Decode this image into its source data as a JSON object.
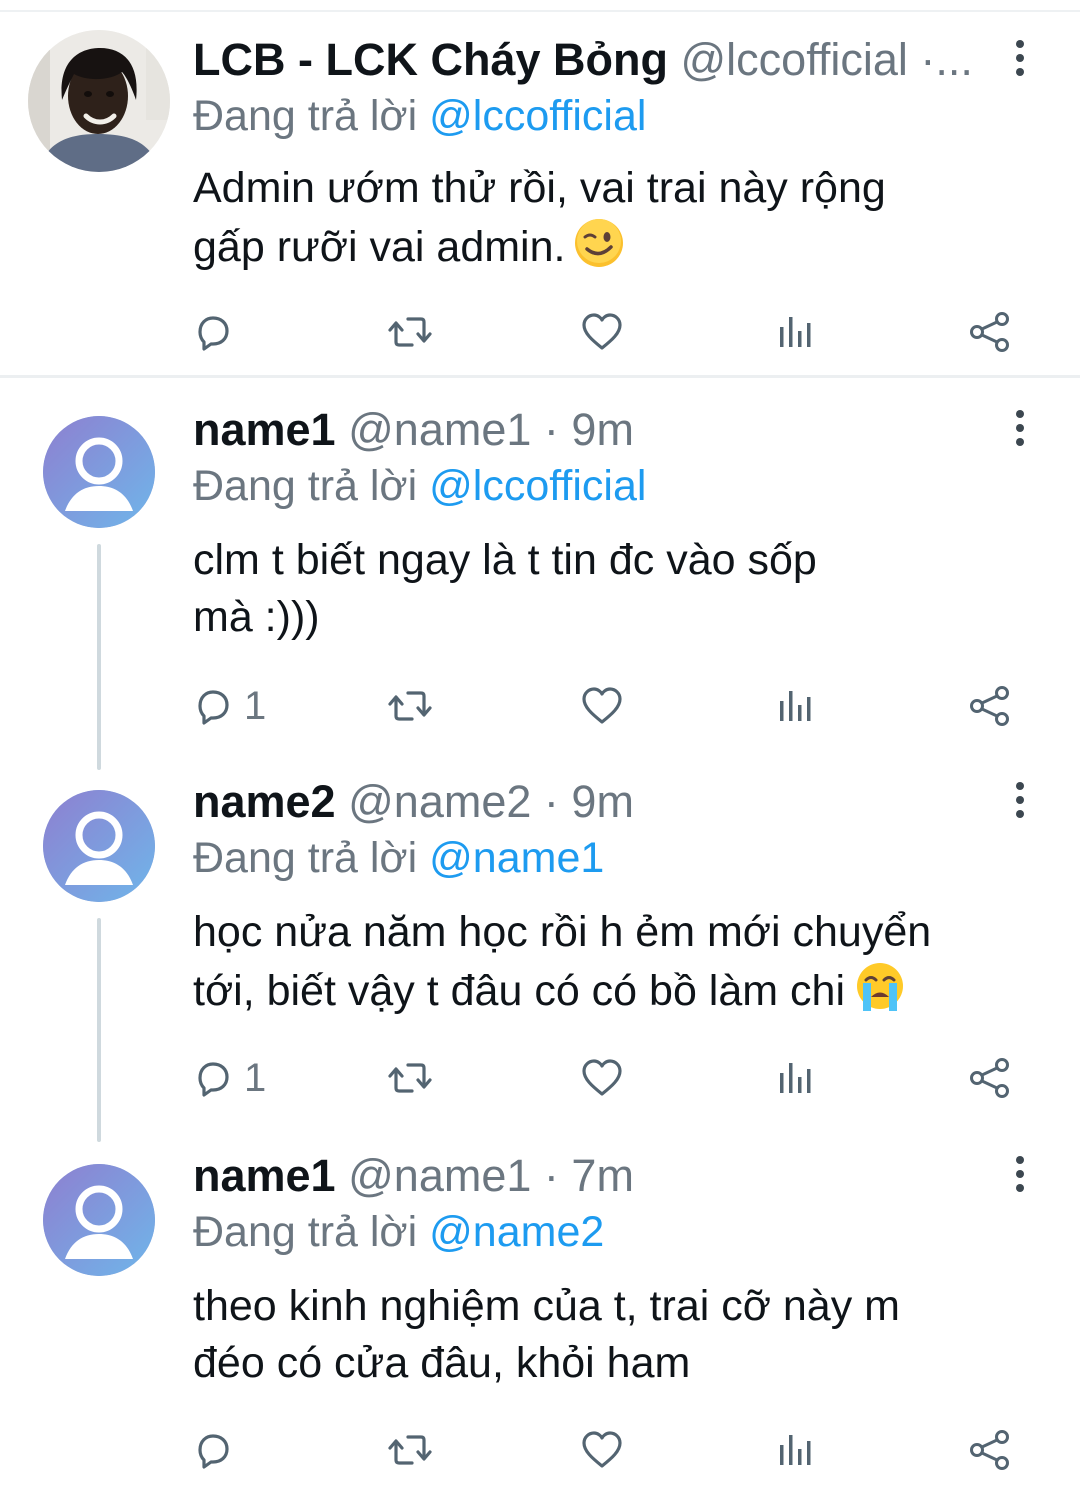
{
  "tweets": [
    {
      "avatar": "user-photo",
      "name": "LCB - LCK Cháy Bỏng",
      "handle": "@lccofficial",
      "time_sep": "·...",
      "time": "",
      "reply_prefix": "Đang trả lời",
      "reply_to": "@lccofficial",
      "lines": [
        "Admin ướm thử rồi, vai trai này rộng",
        "gấp rưỡi vai admin."
      ],
      "emoji": "winking-face-emoji",
      "reply_count": ""
    },
    {
      "avatar": "default-avatar-icon",
      "name": "name1",
      "handle": "@name1",
      "time_sep": "·",
      "time": "9m",
      "reply_prefix": "Đang trả lời",
      "reply_to": "@lccofficial",
      "lines": [
        "clm t biết ngay là t tin đc vào sốp",
        "mà :)))"
      ],
      "emoji": "",
      "reply_count": "1"
    },
    {
      "avatar": "default-avatar-icon",
      "name": "name2",
      "handle": "@name2",
      "time_sep": "·",
      "time": "9m",
      "reply_prefix": "Đang trả lời",
      "reply_to": "@name1",
      "lines": [
        "học nửa năm học rồi h ẻm mới chuyển",
        "tới, biết vậy t đâu có có bồ làm chi"
      ],
      "emoji": "loudly-crying-face-emoji",
      "reply_count": "1"
    },
    {
      "avatar": "default-avatar-icon",
      "name": "name1",
      "handle": "@name1",
      "time_sep": "·",
      "time": "7m",
      "reply_prefix": "Đang trả lời",
      "reply_to": "@name2",
      "lines": [
        "theo kinh nghiệm của t, trai cỡ này m",
        "đéo có cửa đâu, khỏi ham"
      ],
      "emoji": "",
      "reply_count": ""
    }
  ],
  "icons": {
    "reply": "reply-icon",
    "retweet": "retweet-icon",
    "like": "heart-icon",
    "stats": "views-icon",
    "share": "share-icon",
    "more": "more-vertical-icon"
  },
  "colors": {
    "link": "#1d9bf0",
    "muted": "#6b7680",
    "text": "#0f1419",
    "default_avatar": "#7d9ad3"
  }
}
